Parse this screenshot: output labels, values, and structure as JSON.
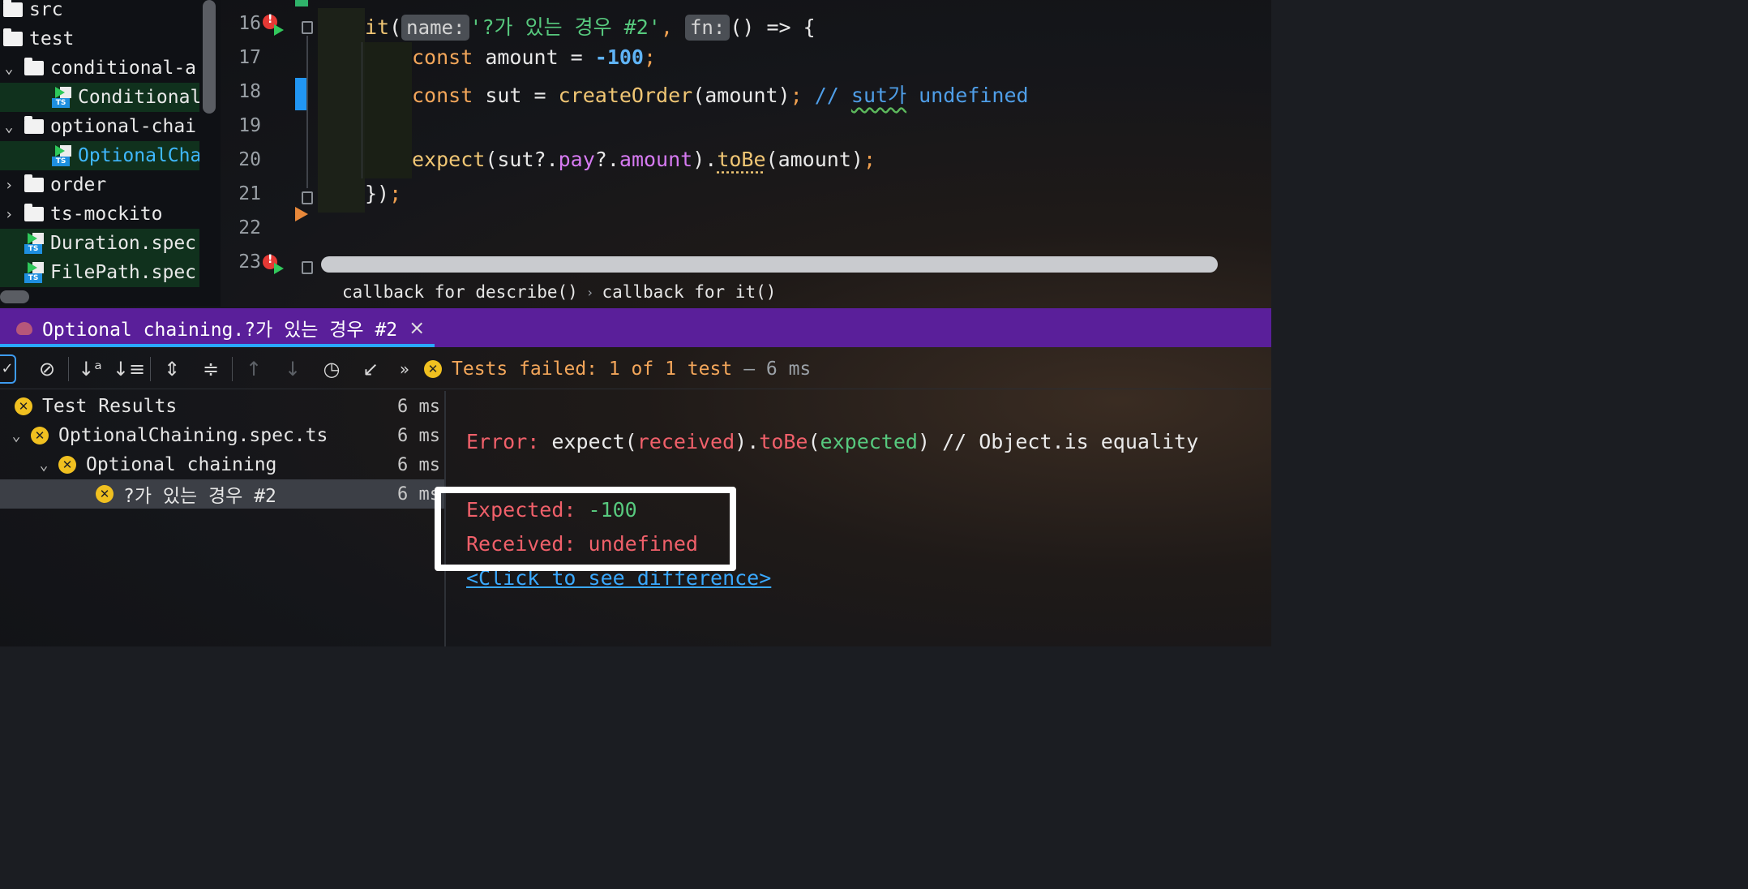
{
  "project_tree": {
    "items": [
      {
        "label": "src",
        "kind": "folder",
        "indent": 0,
        "chevron": ""
      },
      {
        "label": "test",
        "kind": "folder",
        "indent": 0,
        "chevron": ""
      },
      {
        "label": "conditional-a",
        "kind": "folder",
        "indent": 1,
        "chevron": "⌄"
      },
      {
        "label": "Conditional",
        "kind": "ts",
        "indent": 2,
        "chevron": "",
        "selected": true
      },
      {
        "label": "optional-chai",
        "kind": "folder",
        "indent": 1,
        "chevron": "⌄"
      },
      {
        "label": "OptionalCha",
        "kind": "ts",
        "indent": 2,
        "chevron": "",
        "selected": true,
        "active": true
      },
      {
        "label": "order",
        "kind": "folder",
        "indent": 1,
        "chevron": "›"
      },
      {
        "label": "ts-mockito",
        "kind": "folder",
        "indent": 1,
        "chevron": "›"
      },
      {
        "label": "Duration.spec",
        "kind": "ts",
        "indent": 1,
        "chevron": "",
        "selected": true
      },
      {
        "label": "FilePath.spec",
        "kind": "ts",
        "indent": 1,
        "chevron": "",
        "selected": true
      }
    ]
  },
  "editor": {
    "line_numbers": [
      "16",
      "17",
      "18",
      "19",
      "20",
      "21",
      "22",
      "23"
    ],
    "line16": {
      "it": "it",
      "name_hint": "name:",
      "string": "'?가 있는 경우 #2'",
      "comma": ",",
      "fn_hint": "fn:",
      "arrow": "() => {"
    },
    "line17": {
      "const": "const",
      "rest": " amount = ",
      "num": "-100",
      "semi": ";"
    },
    "line18": {
      "const": "const",
      "rest": " sut = ",
      "fn": "createOrder",
      "args": "(amount)",
      "semi": ";",
      "comment_prefix": " // ",
      "comment_word": "sut가",
      "comment_tail": " undefined"
    },
    "line20": {
      "fn": "expect",
      "open": "(sut?.",
      "p1": "pay",
      "mid": "?.",
      "p2": "amount",
      "close": ").",
      "tobe": "toBe",
      "args": "(amount)",
      "semi": ";"
    },
    "line21": {
      "close": "})",
      "semi": ";"
    }
  },
  "breadcrumb": {
    "first": "callback for describe()",
    "separator": "›",
    "second": "callback for it()"
  },
  "run_tab": {
    "label": "Optional chaining.?가 있는 경우 #2",
    "close": "×"
  },
  "toolbar": {
    "status_icon": "✕",
    "status_text": "Tests failed: 1 of 1 test",
    "status_time": "– 6 ms",
    "more": "»"
  },
  "test_results": [
    {
      "label": "Test Results",
      "time": "6 ms",
      "indent": 0,
      "chevron": ""
    },
    {
      "label": "OptionalChaining.spec.ts",
      "time": "6 ms",
      "indent": 1,
      "chevron": "⌄"
    },
    {
      "label": "Optional chaining",
      "time": "6 ms",
      "indent": 2,
      "chevron": "⌄"
    },
    {
      "label": "?가 있는 경우 #2",
      "time": "6 ms",
      "indent": 3,
      "chevron": "",
      "selected": true
    }
  ],
  "output": {
    "error_label": "Error:",
    "error_expect": " expect(",
    "received": "received",
    "mid": ").",
    "tobe": "toBe",
    "paren_open": "(",
    "expected": "expected",
    "tail": ") // Object.is equality",
    "expected_label": "Expected: ",
    "expected_value": "-100",
    "received_label": "Received: ",
    "received_value": "undefined",
    "diff_link": "<Click to see difference>"
  },
  "colors": {
    "run_tab_bg": "#5a1f9a",
    "status_fail": "#f3a65a",
    "error_red": "#f0606a",
    "ok_green": "#57c97e",
    "link_blue": "#3aa9ff"
  }
}
